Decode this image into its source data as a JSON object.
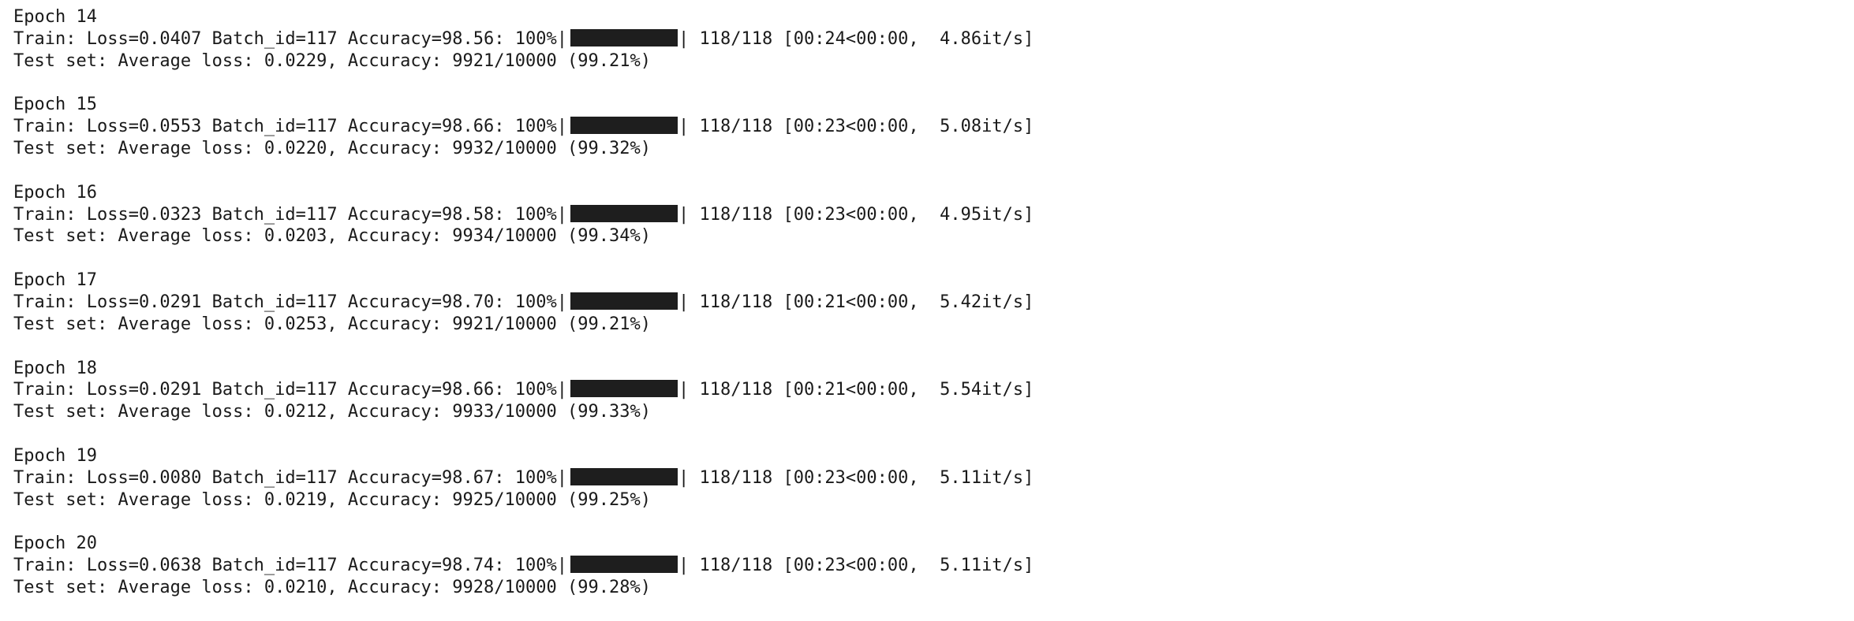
{
  "epochs": [
    {
      "header": "Epoch 14",
      "train_prefix": "Train: Loss=0.0407 Batch_id=117 Accuracy=98.56: 100%",
      "progress": 1.0,
      "train_suffix": " 118/118 [00:24<00:00,  4.86it/s]",
      "test_line": "Test set: Average loss: 0.0229, Accuracy: 9921/10000 (99.21%)"
    },
    {
      "header": "Epoch 15",
      "train_prefix": "Train: Loss=0.0553 Batch_id=117 Accuracy=98.66: 100%",
      "progress": 1.0,
      "train_suffix": " 118/118 [00:23<00:00,  5.08it/s]",
      "test_line": "Test set: Average loss: 0.0220, Accuracy: 9932/10000 (99.32%)"
    },
    {
      "header": "Epoch 16",
      "train_prefix": "Train: Loss=0.0323 Batch_id=117 Accuracy=98.58: 100%",
      "progress": 1.0,
      "train_suffix": " 118/118 [00:23<00:00,  4.95it/s]",
      "test_line": "Test set: Average loss: 0.0203, Accuracy: 9934/10000 (99.34%)"
    },
    {
      "header": "Epoch 17",
      "train_prefix": "Train: Loss=0.0291 Batch_id=117 Accuracy=98.70: 100%",
      "progress": 1.0,
      "train_suffix": " 118/118 [00:21<00:00,  5.42it/s]",
      "test_line": "Test set: Average loss: 0.0253, Accuracy: 9921/10000 (99.21%)"
    },
    {
      "header": "Epoch 18",
      "train_prefix": "Train: Loss=0.0291 Batch_id=117 Accuracy=98.66: 100%",
      "progress": 1.0,
      "train_suffix": " 118/118 [00:21<00:00,  5.54it/s]",
      "test_line": "Test set: Average loss: 0.0212, Accuracy: 9933/10000 (99.33%)"
    },
    {
      "header": "Epoch 19",
      "train_prefix": "Train: Loss=0.0080 Batch_id=117 Accuracy=98.67: 100%",
      "progress": 1.0,
      "train_suffix": " 118/118 [00:23<00:00,  5.11it/s]",
      "test_line": "Test set: Average loss: 0.0219, Accuracy: 9925/10000 (99.25%)"
    },
    {
      "header": "Epoch 20",
      "train_prefix": "Train: Loss=0.0638 Batch_id=117 Accuracy=98.74: 100%",
      "progress": 1.0,
      "train_suffix": " 118/118 [00:23<00:00,  5.11it/s]",
      "test_line": "Test set: Average loss: 0.0210, Accuracy: 9928/10000 (99.28%)"
    }
  ],
  "bar_separator": "|"
}
